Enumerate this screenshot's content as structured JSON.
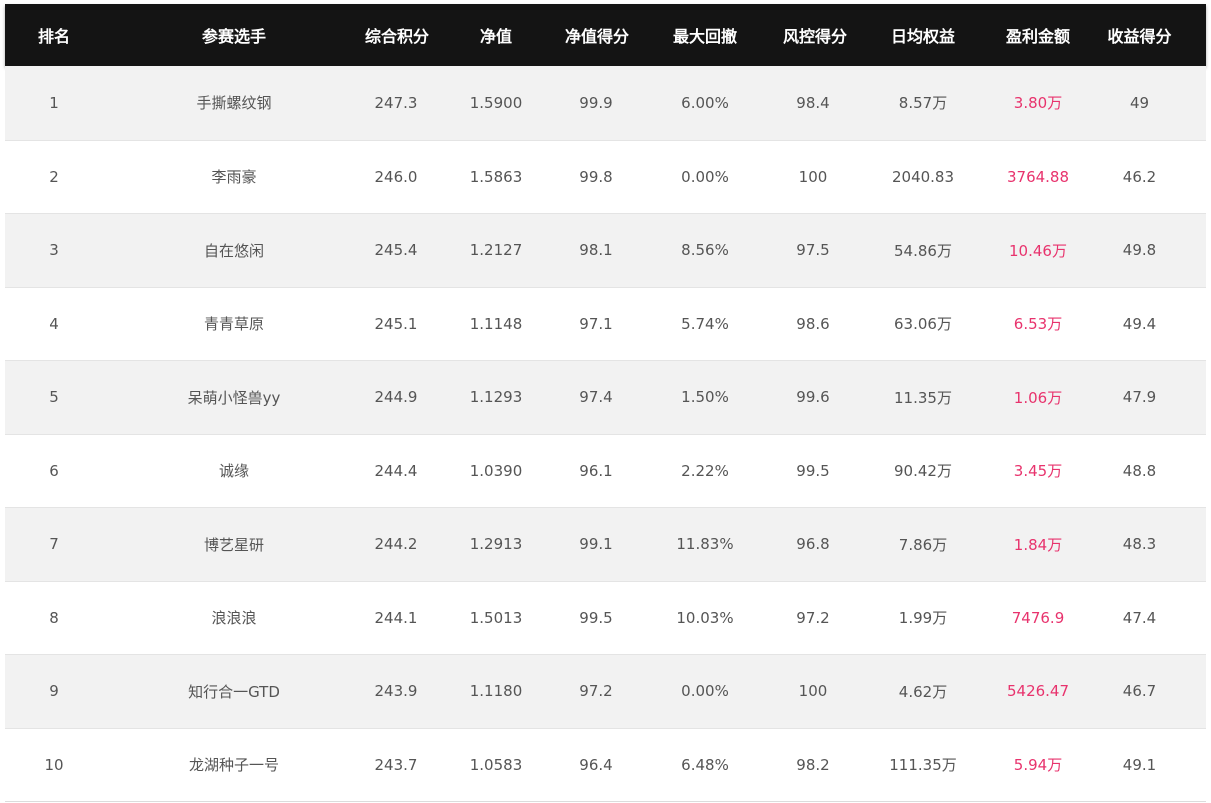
{
  "table": {
    "headers": [
      "排名",
      "参赛选手",
      "综合积分",
      "净值",
      "净值得分",
      "最大回撤",
      "风控得分",
      "日均权益",
      "盈利金额",
      "收益得分"
    ],
    "colors": {
      "header_bg": "#141414",
      "header_text": "#ffffff",
      "row_alt_bg": "#f2f2f2",
      "text": "#555555",
      "profit_text": "#e8336d"
    },
    "rows": [
      {
        "rank": "1",
        "name": "手撕螺纹钢",
        "score": "247.3",
        "nav": "1.5900",
        "nav_score": "99.9",
        "max_drawdown": "6.00%",
        "risk_score": "98.4",
        "daily_equity": "8.57万",
        "profit": "3.80万",
        "return_score": "49"
      },
      {
        "rank": "2",
        "name": "李雨豪",
        "score": "246.0",
        "nav": "1.5863",
        "nav_score": "99.8",
        "max_drawdown": "0.00%",
        "risk_score": "100",
        "daily_equity": "2040.83",
        "profit": "3764.88",
        "return_score": "46.2"
      },
      {
        "rank": "3",
        "name": "自在悠闲",
        "score": "245.4",
        "nav": "1.2127",
        "nav_score": "98.1",
        "max_drawdown": "8.56%",
        "risk_score": "97.5",
        "daily_equity": "54.86万",
        "profit": "10.46万",
        "return_score": "49.8"
      },
      {
        "rank": "4",
        "name": "青青草原",
        "score": "245.1",
        "nav": "1.1148",
        "nav_score": "97.1",
        "max_drawdown": "5.74%",
        "risk_score": "98.6",
        "daily_equity": "63.06万",
        "profit": "6.53万",
        "return_score": "49.4"
      },
      {
        "rank": "5",
        "name": "呆萌小怪兽yy",
        "score": "244.9",
        "nav": "1.1293",
        "nav_score": "97.4",
        "max_drawdown": "1.50%",
        "risk_score": "99.6",
        "daily_equity": "11.35万",
        "profit": "1.06万",
        "return_score": "47.9"
      },
      {
        "rank": "6",
        "name": "诚缘",
        "score": "244.4",
        "nav": "1.0390",
        "nav_score": "96.1",
        "max_drawdown": "2.22%",
        "risk_score": "99.5",
        "daily_equity": "90.42万",
        "profit": "3.45万",
        "return_score": "48.8"
      },
      {
        "rank": "7",
        "name": "博艺星研",
        "score": "244.2",
        "nav": "1.2913",
        "nav_score": "99.1",
        "max_drawdown": "11.83%",
        "risk_score": "96.8",
        "daily_equity": "7.86万",
        "profit": "1.84万",
        "return_score": "48.3"
      },
      {
        "rank": "8",
        "name": "浪浪浪",
        "score": "244.1",
        "nav": "1.5013",
        "nav_score": "99.5",
        "max_drawdown": "10.03%",
        "risk_score": "97.2",
        "daily_equity": "1.99万",
        "profit": "7476.9",
        "return_score": "47.4"
      },
      {
        "rank": "9",
        "name": "知行合一GTD",
        "score": "243.9",
        "nav": "1.1180",
        "nav_score": "97.2",
        "max_drawdown": "0.00%",
        "risk_score": "100",
        "daily_equity": "4.62万",
        "profit": "5426.47",
        "return_score": "46.7"
      },
      {
        "rank": "10",
        "name": "龙湖种子一号",
        "score": "243.7",
        "nav": "1.0583",
        "nav_score": "96.4",
        "max_drawdown": "6.48%",
        "risk_score": "98.2",
        "daily_equity": "111.35万",
        "profit": "5.94万",
        "return_score": "49.1"
      }
    ]
  }
}
